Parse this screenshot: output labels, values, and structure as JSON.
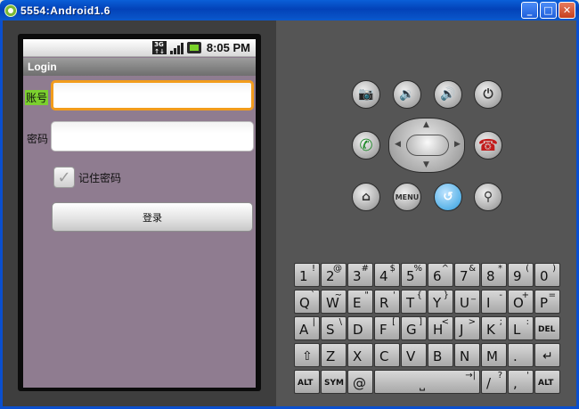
{
  "window": {
    "title": "5554:Android1.6",
    "minimize": "_",
    "maximize": "□",
    "close": "✕"
  },
  "status_bar": {
    "network_top": "3G",
    "network_bottom": "↑↓",
    "time": "8:05 PM"
  },
  "app": {
    "title": "Login",
    "account_label": "账号",
    "account_value": "",
    "password_label": "密码",
    "password_value": "",
    "remember_label": "记住密码",
    "remember_checked": true,
    "login_button": "登录"
  },
  "hardware_buttons": {
    "menu_label": "MENU"
  },
  "keyboard": {
    "row1": [
      {
        "main": "1",
        "alt": "!"
      },
      {
        "main": "2",
        "alt": "@"
      },
      {
        "main": "3",
        "alt": "#"
      },
      {
        "main": "4",
        "alt": "$"
      },
      {
        "main": "5",
        "alt": "%"
      },
      {
        "main": "6",
        "alt": "^"
      },
      {
        "main": "7",
        "alt": "&"
      },
      {
        "main": "8",
        "alt": "*"
      },
      {
        "main": "9",
        "alt": "("
      },
      {
        "main": "0",
        "alt": ")"
      }
    ],
    "row2": [
      {
        "main": "Q",
        "alt": "`"
      },
      {
        "main": "W",
        "alt": "~"
      },
      {
        "main": "E",
        "alt": "\""
      },
      {
        "main": "R",
        "alt": "'"
      },
      {
        "main": "T",
        "alt": "{"
      },
      {
        "main": "Y",
        "alt": "}"
      },
      {
        "main": "U",
        "alt": "_"
      },
      {
        "main": "I",
        "alt": "-"
      },
      {
        "main": "O",
        "alt": "+"
      },
      {
        "main": "P",
        "alt": "="
      }
    ],
    "row3": [
      {
        "main": "A",
        "alt": "|"
      },
      {
        "main": "S",
        "alt": "\\"
      },
      {
        "main": "D",
        "alt": ""
      },
      {
        "main": "F",
        "alt": "["
      },
      {
        "main": "G",
        "alt": "]"
      },
      {
        "main": "H",
        "alt": "<"
      },
      {
        "main": "J",
        "alt": ">"
      },
      {
        "main": "K",
        "alt": ";"
      },
      {
        "main": "L",
        "alt": ":"
      },
      {
        "main": "DEL",
        "alt": ""
      }
    ],
    "row4": [
      {
        "main": "⇧",
        "alt": ""
      },
      {
        "main": "Z",
        "alt": ""
      },
      {
        "main": "X",
        "alt": ""
      },
      {
        "main": "C",
        "alt": ""
      },
      {
        "main": "V",
        "alt": ""
      },
      {
        "main": "B",
        "alt": ""
      },
      {
        "main": "N",
        "alt": ""
      },
      {
        "main": "M",
        "alt": ""
      },
      {
        "main": ".",
        "alt": ""
      },
      {
        "main": "↵",
        "alt": ""
      }
    ],
    "row5": [
      {
        "main": "ALT",
        "alt": ""
      },
      {
        "main": "SYM",
        "alt": ""
      },
      {
        "main": "@",
        "alt": ""
      },
      {
        "main": "⎵",
        "alt": "→|"
      },
      {
        "main": "/",
        "alt": "?"
      },
      {
        "main": ",",
        "alt": "'"
      },
      {
        "main": "ALT",
        "alt": ""
      }
    ]
  }
}
